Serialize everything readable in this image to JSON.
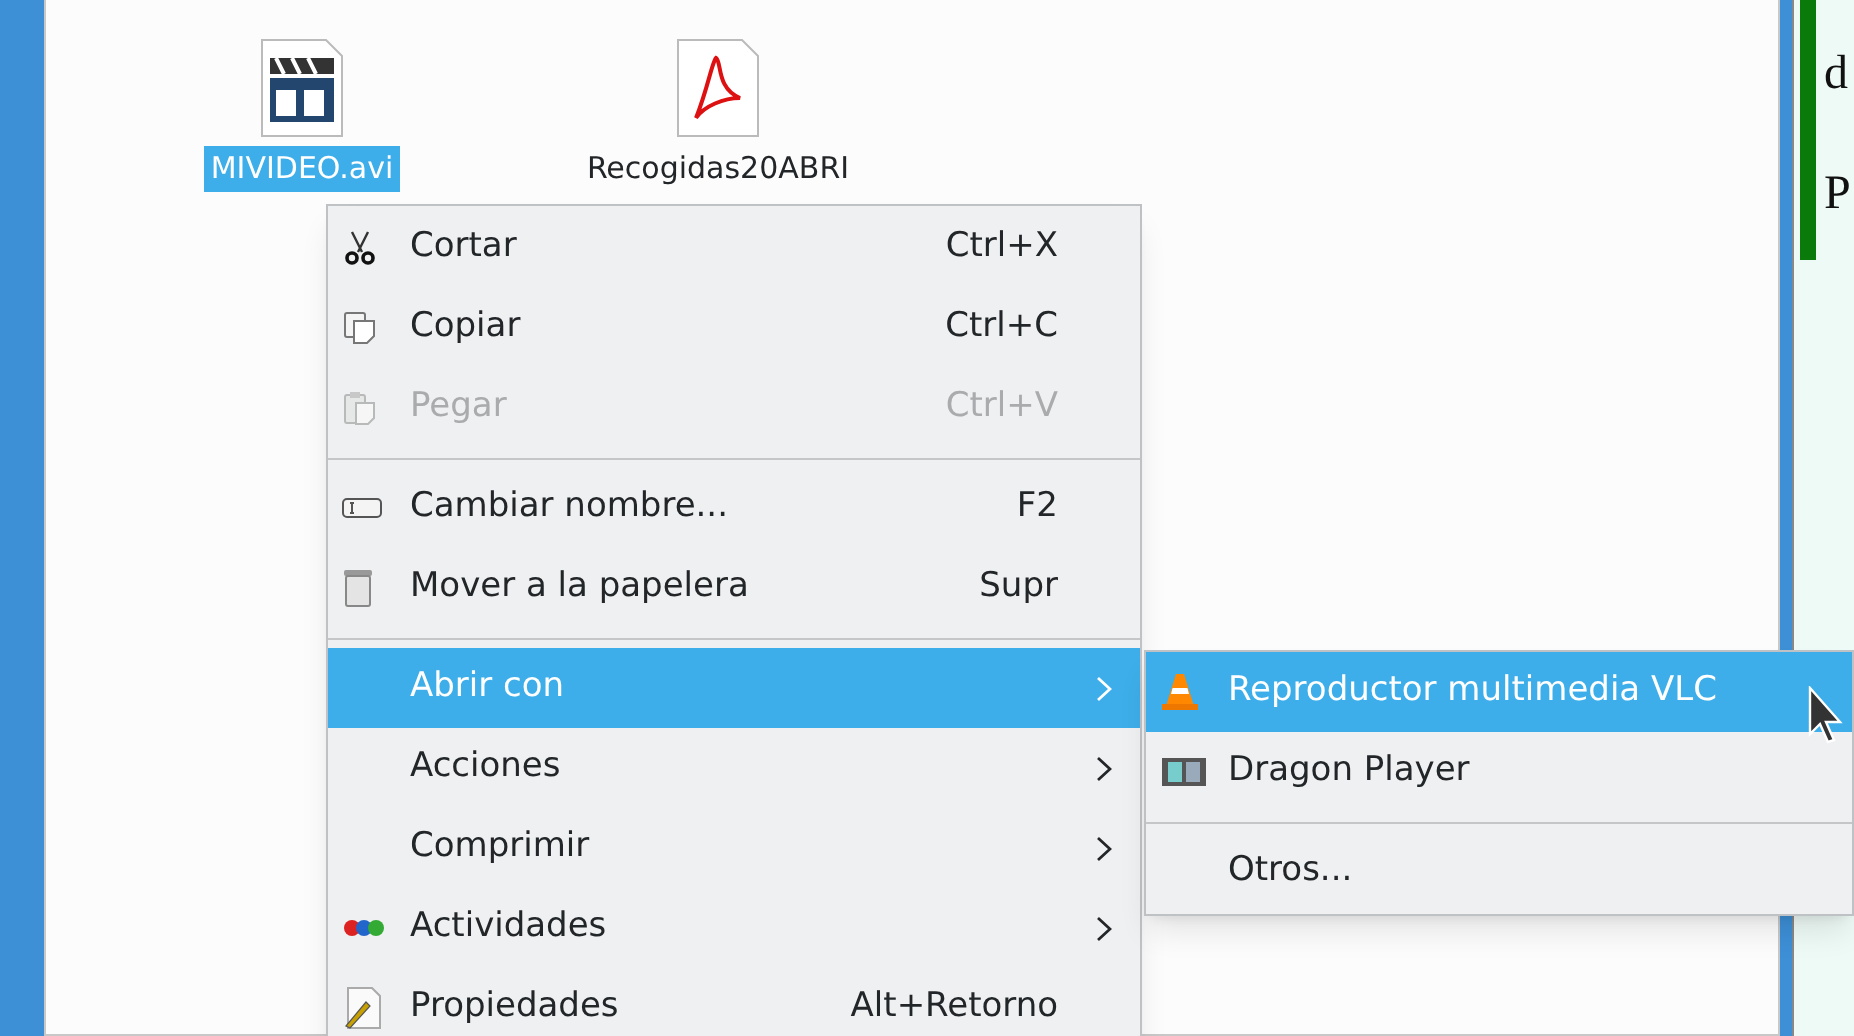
{
  "files": [
    {
      "name": "MIVIDEO.avi",
      "selected": true
    },
    {
      "name": "Recogidas20ABRI",
      "selected": false
    }
  ],
  "side_window": {
    "lines": [
      "d",
      "P"
    ]
  },
  "context_menu": [
    {
      "kind": "item",
      "label": "Cortar",
      "shortcut": "Ctrl+X",
      "disabled": false,
      "selected": false,
      "submenu": false
    },
    {
      "kind": "item",
      "label": "Copiar",
      "shortcut": "Ctrl+C",
      "disabled": false,
      "selected": false,
      "submenu": false
    },
    {
      "kind": "item",
      "label": "Pegar",
      "shortcut": "Ctrl+V",
      "disabled": true,
      "selected": false,
      "submenu": false
    },
    {
      "kind": "separator"
    },
    {
      "kind": "item",
      "label": "Cambiar nombre...",
      "shortcut": "F2",
      "disabled": false,
      "selected": false,
      "submenu": false
    },
    {
      "kind": "item",
      "label": "Mover a la papelera",
      "shortcut": "Supr",
      "disabled": false,
      "selected": false,
      "submenu": false
    },
    {
      "kind": "separator"
    },
    {
      "kind": "item",
      "label": "Abrir con",
      "disabled": false,
      "selected": true,
      "submenu": true
    },
    {
      "kind": "item",
      "label": "Acciones",
      "disabled": false,
      "selected": false,
      "submenu": true
    },
    {
      "kind": "item",
      "label": "Comprimir",
      "disabled": false,
      "selected": false,
      "submenu": true
    },
    {
      "kind": "item",
      "label": "Actividades",
      "disabled": false,
      "selected": false,
      "submenu": true
    },
    {
      "kind": "item",
      "label": "Propiedades",
      "shortcut": "Alt+Retorno",
      "disabled": false,
      "selected": false,
      "submenu": false
    }
  ],
  "submenu": [
    {
      "kind": "item",
      "label": "Reproductor multimedia VLC",
      "selected": true
    },
    {
      "kind": "item",
      "label": "Dragon Player",
      "selected": false
    },
    {
      "kind": "separator"
    },
    {
      "kind": "item",
      "label": "Otros...",
      "selected": false
    }
  ]
}
